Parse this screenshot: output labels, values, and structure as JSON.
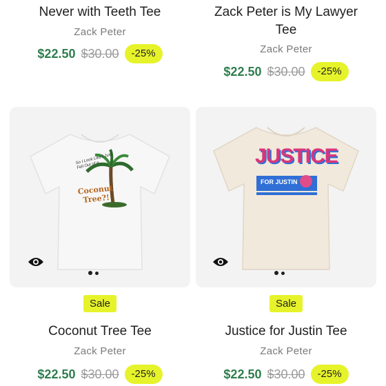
{
  "products": [
    {
      "title": "Never with Teeth Tee",
      "vendor": "Zack Peter",
      "price": "$22.50",
      "compare_price": "$30.00",
      "discount": "-25%"
    },
    {
      "title_line1": "Zack Peter is My Lawyer",
      "title_line2": "Tee",
      "vendor": "Zack Peter",
      "price": "$22.50",
      "compare_price": "$30.00",
      "discount": "-25%"
    },
    {
      "badge": "Sale",
      "title": "Coconut Tree Tee",
      "vendor": "Zack Peter",
      "price": "$22.50",
      "compare_price": "$30.00",
      "discount": "-25%",
      "shirt_color": "#f7f7f7",
      "graphic_text_top": "So I Look Like I Just Fell Out of a",
      "graphic_text_main": "Coconut Tree?!"
    },
    {
      "badge": "Sale",
      "title": "Justice for Justin Tee",
      "vendor": "Zack Peter",
      "price": "$22.50",
      "compare_price": "$30.00",
      "discount": "-25%",
      "shirt_color": "#f1e9dc",
      "graphic_text_main": "JUSTICE",
      "graphic_text_sub": "FOR JUSTIN"
    }
  ],
  "colors": {
    "price_green": "#2f7d4e",
    "badge_yellow": "#e6f32a",
    "card_bg": "#f3f3f3"
  },
  "icons": {
    "quick_view": "eye-icon"
  }
}
